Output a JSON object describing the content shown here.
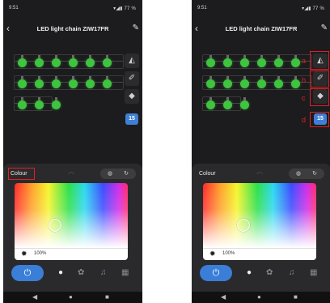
{
  "status": {
    "time": "9:51",
    "battery": "77 %",
    "signal_icons": "wifi-signal-battery"
  },
  "header": {
    "title": "LED light chain ZIW17FR"
  },
  "tools": {
    "brightness_value": "15"
  },
  "panel": {
    "label": "Colour",
    "brightness": "100%"
  },
  "annotations": {
    "a": "a",
    "b": "b",
    "c": "c",
    "d": "d"
  },
  "colors": {
    "accent": "#3a7ed8",
    "bulb": "#3ec43e",
    "highlight": "#e02020"
  }
}
